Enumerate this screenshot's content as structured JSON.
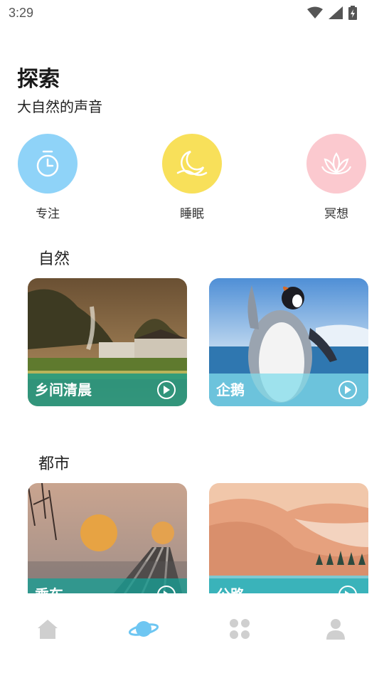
{
  "status_bar": {
    "time": "3:29"
  },
  "header": {
    "title": "探索",
    "subtitle": "大自然的声音"
  },
  "categories": [
    {
      "label": "专注",
      "icon": "timer-icon",
      "color": "#8fd3f8"
    },
    {
      "label": "睡眠",
      "icon": "moon-icon",
      "color": "#f8e05a"
    },
    {
      "label": "冥想",
      "icon": "lotus-icon",
      "color": "#fbc9cf"
    }
  ],
  "sections": [
    {
      "title": "自然",
      "cards": [
        {
          "title": "乡间清晨"
        },
        {
          "title": "企鹅"
        }
      ]
    },
    {
      "title": "都市",
      "cards": [
        {
          "title": "乘车"
        },
        {
          "title": "公路"
        }
      ]
    }
  ],
  "bottom_nav": [
    {
      "icon": "home-icon",
      "active": false
    },
    {
      "icon": "planet-icon",
      "active": true
    },
    {
      "icon": "grid-icon",
      "active": false
    },
    {
      "icon": "profile-icon",
      "active": false
    }
  ],
  "colors": {
    "accent": "#6ec6f2",
    "inactive": "#cfcfcf"
  }
}
